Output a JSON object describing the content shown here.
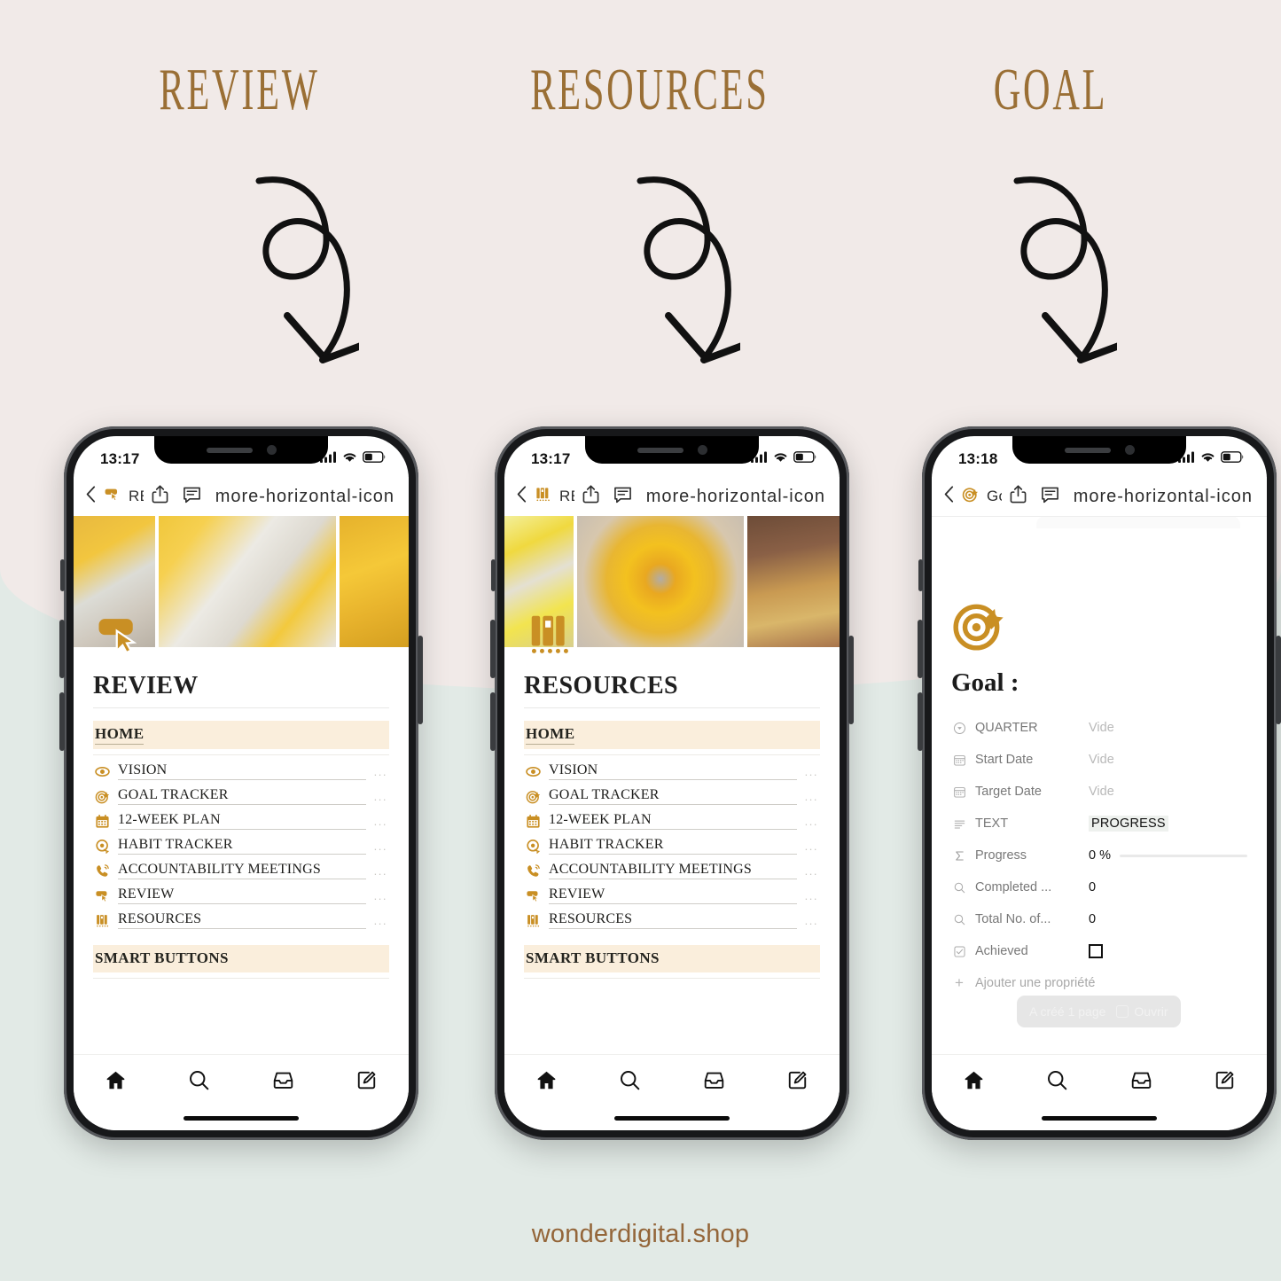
{
  "headings": [
    {
      "label": "REVIEW"
    },
    {
      "label": "RESOURCES"
    },
    {
      "label": "GOAL"
    }
  ],
  "colors": {
    "bg_top": "#f1eae8",
    "bg_bottom": "#e2eae6",
    "brand_gold": "#c98f24",
    "heading_brown": "#9a6f35",
    "band_cream": "#faeedc",
    "footer_brown": "#94663a"
  },
  "phones": [
    {
      "status": {
        "time": "13:17",
        "signal_icon": "cellular-bars-icon",
        "wifi_icon": "wifi-icon",
        "battery_icon": "battery-icon"
      },
      "navbar": {
        "back_icon": "chevron-left-icon",
        "page_icon": "cursor-click-icon",
        "title": "REVIEW",
        "share_icon": "share-icon",
        "comment_icon": "comment-icon",
        "more_icon": "more-horizontal-icon"
      },
      "cover": {
        "type": "photo-collage",
        "theme": "yellow"
      },
      "page_icon": "cursor-click-icon",
      "page_title": "REVIEW",
      "sections": [
        {
          "band": "HOME",
          "underlined": true,
          "links": [
            {
              "icon": "eye-icon",
              "label": "VISION",
              "menu": "..."
            },
            {
              "icon": "target-icon",
              "label": "GOAL TRACKER",
              "menu": "..."
            },
            {
              "icon": "calendar-icon",
              "label": "12-WEEK PLAN",
              "menu": "..."
            },
            {
              "icon": "habit-clock-icon",
              "label": "HABIT TRACKER",
              "menu": "..."
            },
            {
              "icon": "phone-call-icon",
              "label": "ACCOUNTABILITY MEETINGS",
              "menu": "..."
            },
            {
              "icon": "cursor-click-icon",
              "label": "REVIEW",
              "menu": "..."
            },
            {
              "icon": "books-icon",
              "label": "RESOURCES",
              "menu": "..."
            }
          ]
        },
        {
          "band": "SMART BUTTONS",
          "underlined": false,
          "links": []
        }
      ],
      "tabbar": [
        "home-icon",
        "search-icon",
        "inbox-icon",
        "compose-icon"
      ]
    },
    {
      "status": {
        "time": "13:17",
        "signal_icon": "cellular-bars-icon",
        "wifi_icon": "wifi-icon",
        "battery_icon": "battery-icon"
      },
      "navbar": {
        "back_icon": "chevron-left-icon",
        "page_icon": "books-icon",
        "title": "RESOURCES",
        "share_icon": "share-icon",
        "comment_icon": "comment-icon",
        "more_icon": "more-horizontal-icon"
      },
      "cover": {
        "type": "photo-collage",
        "theme": "yellow"
      },
      "page_icon": "books-icon",
      "page_title": "RESOURCES",
      "sections": [
        {
          "band": "HOME",
          "underlined": true,
          "links": [
            {
              "icon": "eye-icon",
              "label": "VISION",
              "menu": "..."
            },
            {
              "icon": "target-icon",
              "label": "GOAL TRACKER",
              "menu": "..."
            },
            {
              "icon": "calendar-icon",
              "label": "12-WEEK PLAN",
              "menu": "..."
            },
            {
              "icon": "habit-clock-icon",
              "label": "HABIT TRACKER",
              "menu": "..."
            },
            {
              "icon": "phone-call-icon",
              "label": "ACCOUNTABILITY MEETINGS",
              "menu": "..."
            },
            {
              "icon": "cursor-click-icon",
              "label": "REVIEW",
              "menu": "..."
            },
            {
              "icon": "books-icon",
              "label": "RESOURCES",
              "menu": "..."
            }
          ]
        },
        {
          "band": "SMART BUTTONS",
          "underlined": false,
          "links": []
        }
      ],
      "tabbar": [
        "home-icon",
        "search-icon",
        "inbox-icon",
        "compose-icon"
      ]
    },
    {
      "status": {
        "time": "13:18",
        "signal_icon": "cellular-bars-icon",
        "wifi_icon": "wifi-icon",
        "battery_icon": "battery-icon"
      },
      "navbar": {
        "back_icon": "chevron-left-icon",
        "page_icon": "target-icon",
        "title": "Goal :",
        "share_icon": "share-icon",
        "comment_icon": "comment-icon",
        "more_icon": "more-horizontal-icon"
      },
      "page_icon": "target-icon",
      "page_title": "Goal :",
      "properties": [
        {
          "icon": "select-icon",
          "name": "QUARTER",
          "value": "Vide",
          "empty": true
        },
        {
          "icon": "calendar-icon",
          "name": "Start Date",
          "value": "Vide",
          "empty": true
        },
        {
          "icon": "calendar-icon",
          "name": "Target Date",
          "value": "Vide",
          "empty": true
        },
        {
          "icon": "text-icon",
          "name": "TEXT",
          "value": "PROGRESS",
          "empty": false,
          "highlight": true
        },
        {
          "icon": "sigma-icon",
          "name": "Progress",
          "value": "0 %",
          "empty": false,
          "progress_bar": true
        },
        {
          "icon": "rollup-icon",
          "name": "Completed ...",
          "value": "0",
          "empty": false
        },
        {
          "icon": "rollup-icon",
          "name": "Total No. of...",
          "value": "0",
          "empty": false
        },
        {
          "icon": "checkbox-icon",
          "name": "Achieved",
          "value": "",
          "empty": false,
          "checkbox": true,
          "checked": false
        }
      ],
      "add_property": {
        "icon": "plus-icon",
        "label": "Ajouter une propriété"
      },
      "toast": {
        "message": "A créé 1 page",
        "action_icon": "open-external-icon",
        "action_label": "Ouvrir"
      },
      "tabbar": [
        "home-icon",
        "search-icon",
        "inbox-icon",
        "compose-icon"
      ]
    }
  ],
  "arrows": [
    {
      "name": "curly-arrow-icon"
    },
    {
      "name": "curly-arrow-icon"
    },
    {
      "name": "curly-arrow-icon"
    }
  ],
  "footer": {
    "text": "wonderdigital.shop"
  }
}
